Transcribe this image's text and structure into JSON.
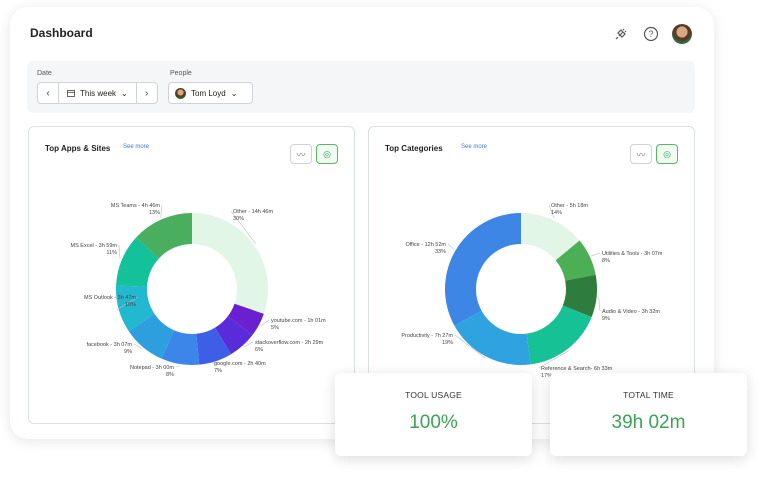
{
  "header": {
    "title": "Dashboard",
    "icons": [
      "plug-icon",
      "help-icon",
      "user-avatar"
    ]
  },
  "filters": {
    "date_label": "Date",
    "date_value": "This week",
    "people_label": "People",
    "people_value": "Tom Loyd"
  },
  "panels": [
    {
      "title": "Top Apps & Sites",
      "see_more": "See more",
      "slices": [
        {
          "name": "Other",
          "time": "14h 46m",
          "percent": 30,
          "color": "#e1f6e6",
          "label": "Other - 14h 46m",
          "pct": "30%"
        },
        {
          "name": "youtube.com",
          "time": "1h 01m",
          "percent": 5,
          "color": "#6a1fd1",
          "label": "youtube.com - 1h 01m",
          "pct": "5%"
        },
        {
          "name": "stackoverflow.com",
          "time": "2h 29m",
          "percent": 6,
          "color": "#5a2bd8",
          "label": "stackoverflow.com - 2h 29m",
          "pct": "6%"
        },
        {
          "name": "google.com",
          "time": "2h 40m",
          "percent": 7,
          "color": "#3f5ee8",
          "label": "google.com - 2h 40m",
          "pct": "7%"
        },
        {
          "name": "Notepad",
          "time": "3h 00m",
          "percent": 8,
          "color": "#3b86e8",
          "label": "Notepad - 3h 00m",
          "pct": "8%"
        },
        {
          "name": "facebook",
          "time": "3h 07m",
          "percent": 9,
          "color": "#2e9fde",
          "label": "facebook - 3h 07m",
          "pct": "9%"
        },
        {
          "name": "MS Outlook",
          "time": "3h 47m",
          "percent": 10,
          "color": "#22b8cf",
          "label": "MS Outlook - 3h 47m",
          "pct": "10%"
        },
        {
          "name": "MS Excel",
          "time": "3h 59m",
          "percent": 11,
          "color": "#13c29a",
          "label": "MS Excel - 3h 59m",
          "pct": "11%"
        },
        {
          "name": "MS Teams",
          "time": "4h 46m",
          "percent": 13,
          "color": "#4aae5f",
          "label": "MS Teams - 4h 46m",
          "pct": "13%"
        }
      ]
    },
    {
      "title": "Top Categories",
      "see_more": "See more",
      "slices": [
        {
          "name": "Other",
          "time": "5h 18m",
          "percent": 14,
          "color": "#e1f6e6",
          "label": "Other - 5h 18m",
          "pct": "14%"
        },
        {
          "name": "Utilities & Tools",
          "time": "3h 07m",
          "percent": 8,
          "color": "#4caf55",
          "label": "Utilities & Tools - 3h 07m",
          "pct": "8%"
        },
        {
          "name": "Audio & Video",
          "time": "3h 32m",
          "percent": 9,
          "color": "#2e7d3e",
          "label": "Audio & Video - 3h 32m",
          "pct": "9%"
        },
        {
          "name": "Reference & Search",
          "time": "6h 33m",
          "percent": 17,
          "color": "#16c196",
          "label": "Reference & Search- 6h 33m",
          "pct": "17%"
        },
        {
          "name": "Productivity",
          "time": "7h 27m",
          "percent": 19,
          "color": "#2fa2e0",
          "label": "Productivity - 7h 27m",
          "pct": "19%"
        },
        {
          "name": "Office",
          "time": "12h 52m",
          "percent": 33,
          "color": "#3d86e6",
          "label": "Office - 12h 52m",
          "pct": "33%"
        }
      ]
    }
  ],
  "kpis": [
    {
      "label": "TOOL USAGE",
      "value": "100%"
    },
    {
      "label": "TOTAL TIME",
      "value": "39h 02m"
    }
  ],
  "chart_data": [
    {
      "type": "pie",
      "title": "Top Apps & Sites",
      "categories": [
        "Other",
        "youtube.com",
        "stackoverflow.com",
        "google.com",
        "Notepad",
        "facebook",
        "MS Outlook",
        "MS Excel",
        "MS Teams"
      ],
      "values": [
        30,
        5,
        6,
        7,
        8,
        9,
        10,
        11,
        13
      ]
    },
    {
      "type": "pie",
      "title": "Top Categories",
      "categories": [
        "Other",
        "Utilities & Tools",
        "Audio & Video",
        "Reference & Search",
        "Productivity",
        "Office"
      ],
      "values": [
        14,
        8,
        9,
        17,
        19,
        33
      ]
    }
  ]
}
